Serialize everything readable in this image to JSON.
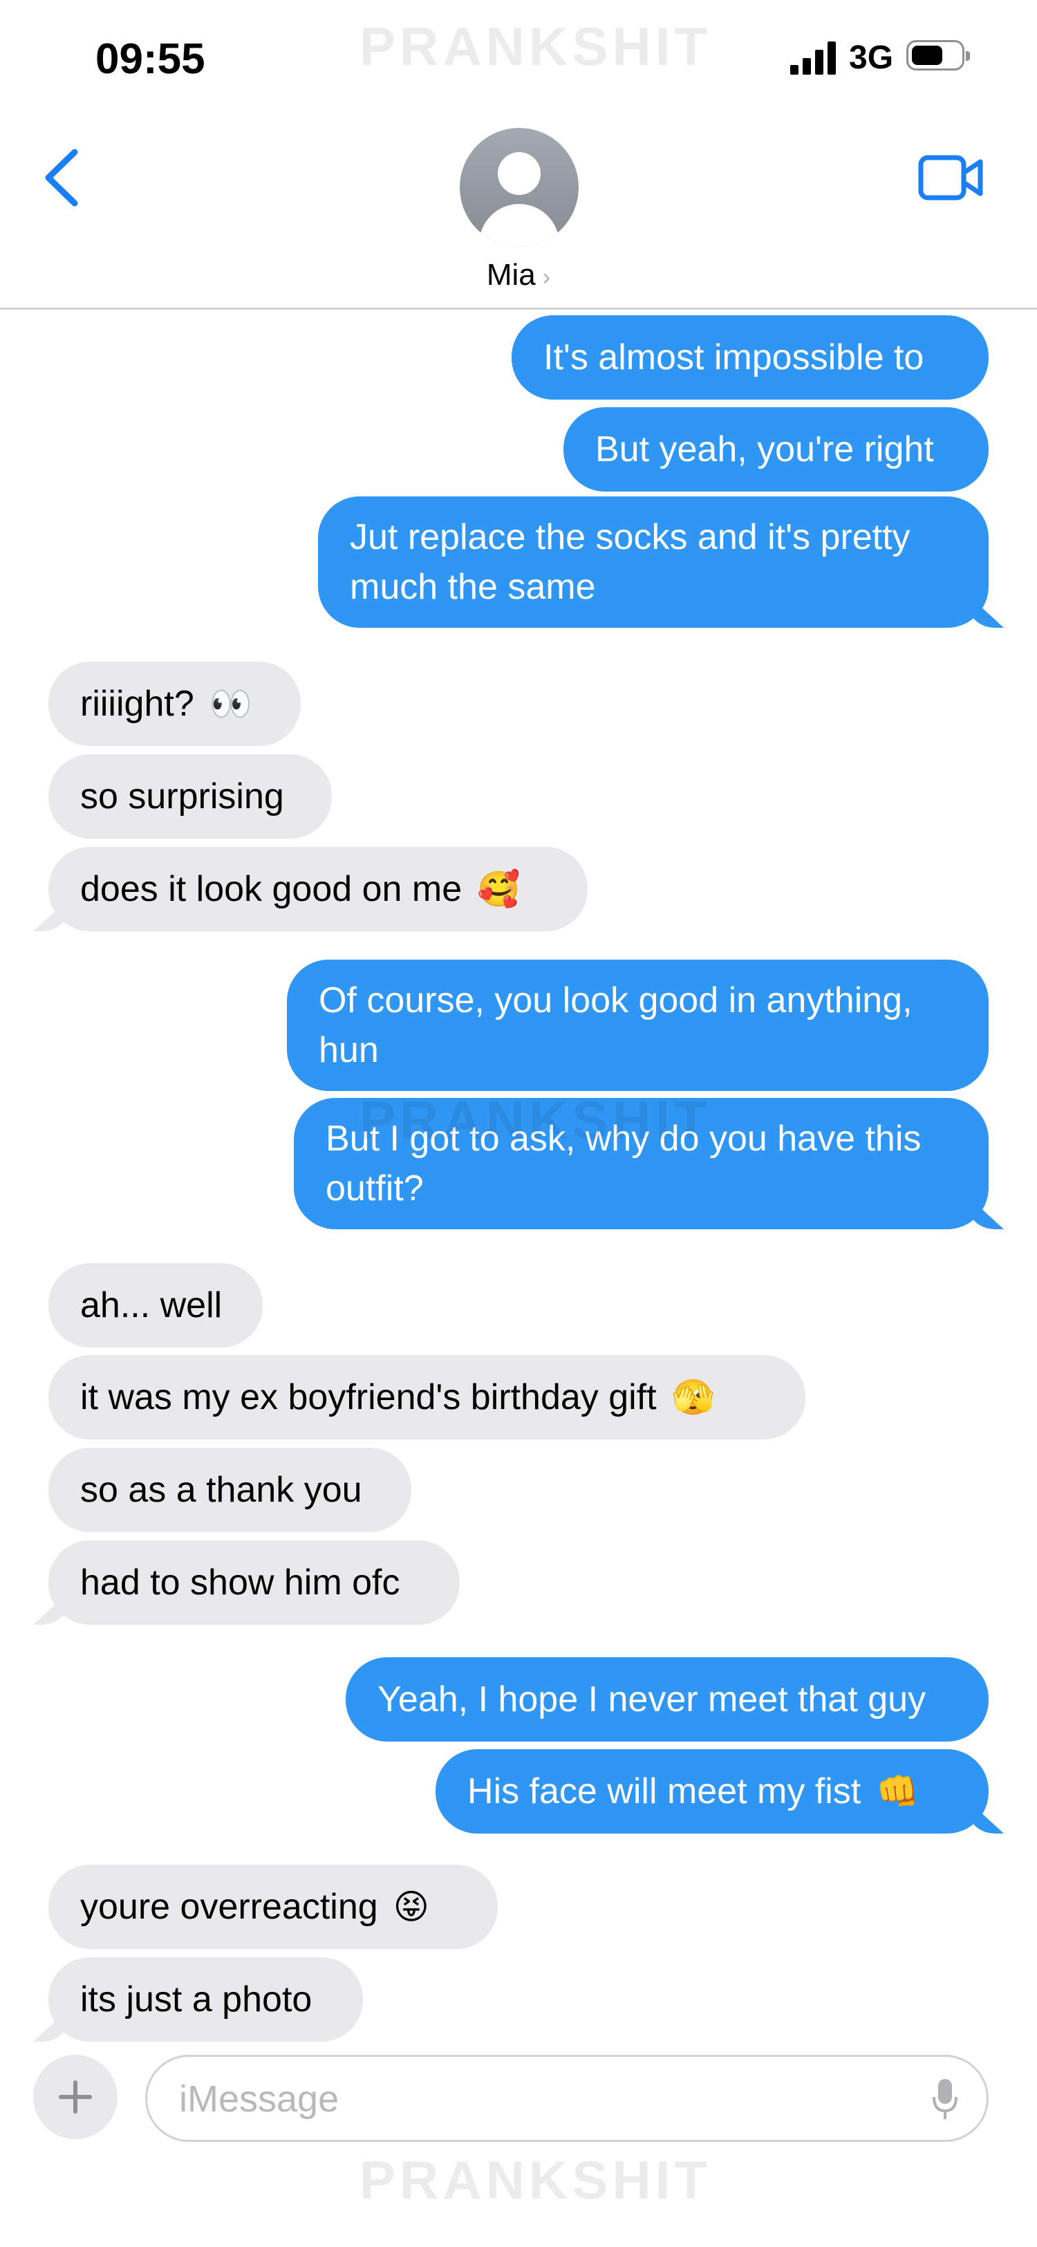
{
  "status_bar": {
    "time": "09:55",
    "network": "3G"
  },
  "watermark": "PRANKSHIT",
  "header": {
    "contact_name": "Mia",
    "chevron": "›",
    "back_icon": "chevron-left-icon",
    "video_icon": "video-camera-icon"
  },
  "colors": {
    "sent_bubble": "#2f96f4",
    "received_bubble": "#e9e9eb",
    "accent": "#1a7ff5"
  },
  "messages": [
    {
      "direction": "sent",
      "text": "It's almost impossible to"
    },
    {
      "direction": "sent",
      "text": "But yeah, you're right"
    },
    {
      "direction": "sent",
      "text": "Jut replace the socks and it's pretty\nmuch the same"
    },
    {
      "direction": "received",
      "text": "riiiight?",
      "emoji": "👀"
    },
    {
      "direction": "received",
      "text": "so surprising"
    },
    {
      "direction": "received",
      "text": "does it look good on me",
      "emoji": "🥰"
    },
    {
      "direction": "sent",
      "text": "Of course, you look good in anything,\nhun"
    },
    {
      "direction": "sent",
      "text": "But I got to ask, why do you have this\noutfit?"
    },
    {
      "direction": "received",
      "text": "ah... well"
    },
    {
      "direction": "received",
      "text": "it was my ex boyfriend's birthday gift",
      "emoji": "🫣"
    },
    {
      "direction": "received",
      "text": "so as a thank you"
    },
    {
      "direction": "received",
      "text": "had to show him ofc"
    },
    {
      "direction": "sent",
      "text": "Yeah, I hope I never meet that guy"
    },
    {
      "direction": "sent",
      "text": "His face will meet my fist",
      "emoji": "👊"
    },
    {
      "direction": "received",
      "text": "youre overreacting",
      "emoji": "😝"
    },
    {
      "direction": "received",
      "text": "its just a photo"
    }
  ],
  "composer": {
    "placeholder": "iMessage",
    "add_icon": "plus-icon",
    "mic_icon": "microphone-icon"
  }
}
